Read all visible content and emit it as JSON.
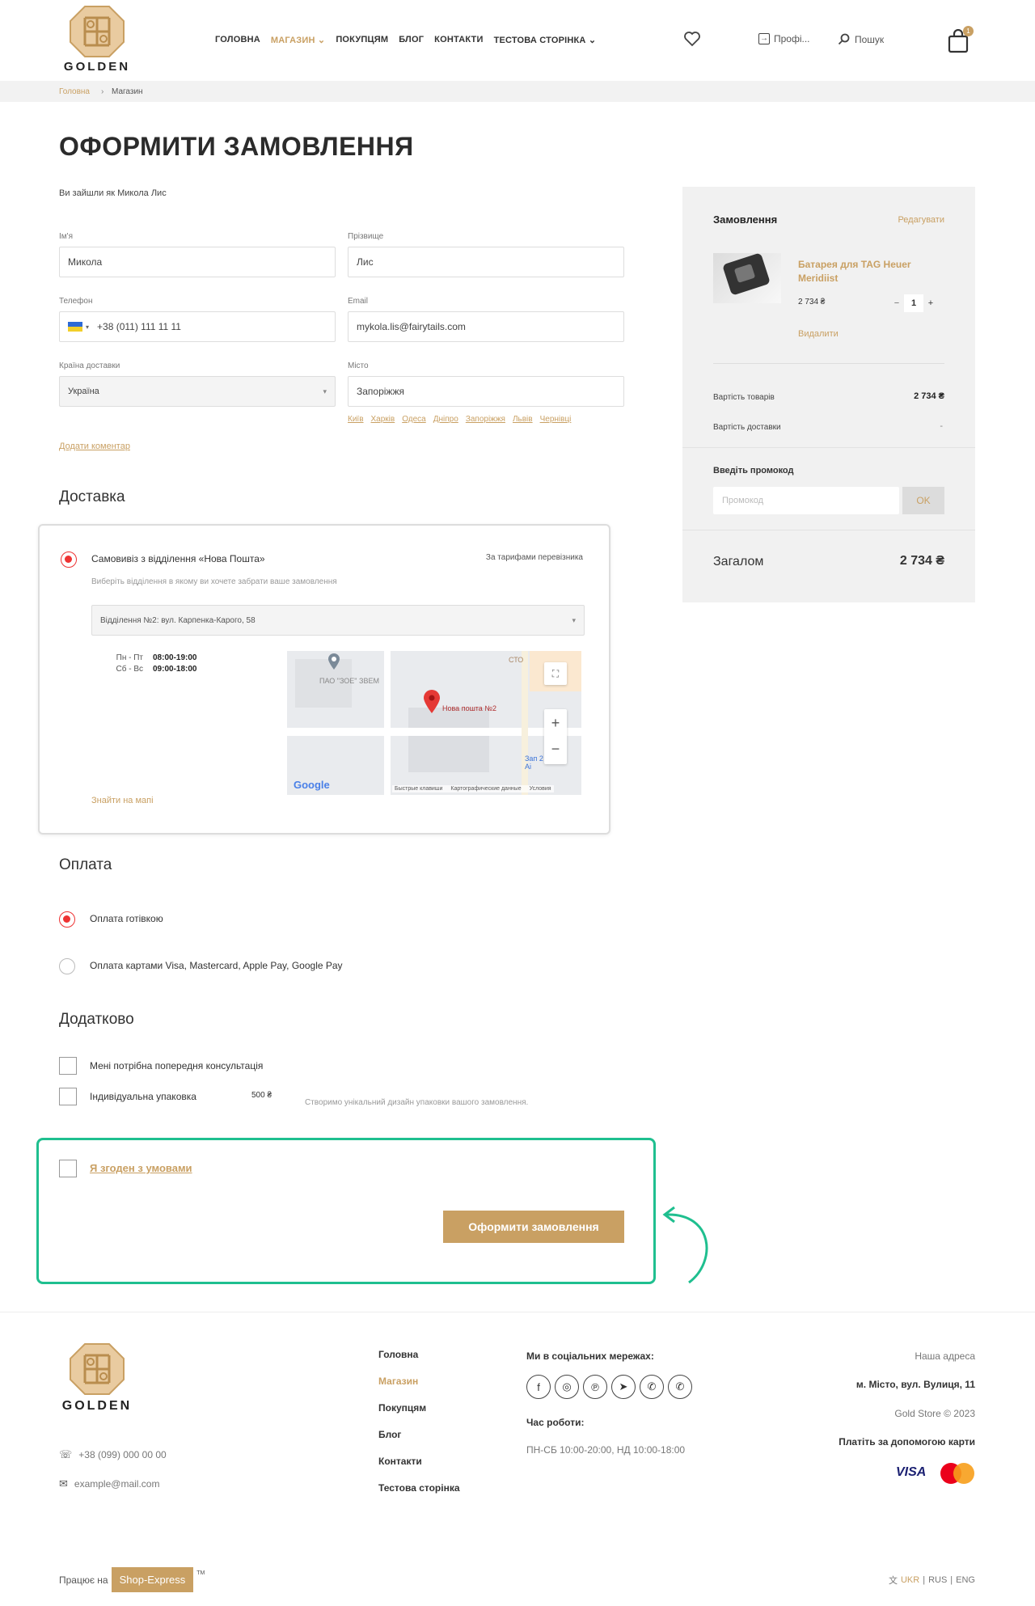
{
  "header": {
    "logo_text": "GOLDEN",
    "nav": [
      {
        "label": "ГОЛОВНА"
      },
      {
        "label": "МАГАЗИН ⌄"
      },
      {
        "label": "ПОКУПЦЯМ"
      },
      {
        "label": "БЛОГ"
      },
      {
        "label": "КОНТАКТИ"
      },
      {
        "label": "ТЕСТОВА СТОРІНКА ⌄"
      }
    ],
    "profile_label": "Профі...",
    "search_label": "Пошук",
    "cart_count": "1",
    "accent_color": "#c9a063"
  },
  "breadcrumb": {
    "home": "Головна",
    "sep": "›",
    "current": "Магазин"
  },
  "page_title": "ОФОРМИТИ ЗАМОВЛЕННЯ",
  "logged_in_text": "Ви зайшли як Микола Лис",
  "form": {
    "first_name_label": "Ім'я",
    "first_name_value": "Микола",
    "last_name_label": "Прізвище",
    "last_name_value": "Лис",
    "phone_label": "Телефон",
    "phone_value": "+38 (011) 111 11 11",
    "email_label": "Email",
    "email_value": "mykola.lis@fairytails.com",
    "country_label": "Країна доставки",
    "country_value": "Україна",
    "city_label": "Місто",
    "city_value": "Запоріжжя",
    "city_suggestions": [
      "Київ",
      "Харків",
      "Одеса",
      "Дніпро",
      "Запоріжжя",
      "Львів",
      "Чернівці"
    ],
    "add_comment": "Додати коментар"
  },
  "delivery": {
    "title": "Доставка",
    "option_label": "Самовивіз з відділення «Нова Пошта»",
    "tariff": "За тарифами перевізника",
    "hint": "Виберіть відділення в якому ви хочете забрати ваше замовлення",
    "branch_value": "Відділення №2: вул. Карпенка-Карого, 58",
    "schedule": [
      {
        "days": "Пн - Пт",
        "hours": "08:00-19:00"
      },
      {
        "days": "Сб - Вс",
        "hours": "09:00-18:00"
      }
    ],
    "find_on_map": "Знайти на мапі",
    "map": {
      "poi_1": "ПАО \"ЗОЕ\" ЗВЕМ",
      "poi_2": "Нова пошта №2",
      "poi_3": "СТО",
      "poi_4": "Зап 2 Аі",
      "brand": "Google",
      "footer_1": "Быстрые клавиши",
      "footer_2": "Картографические данные",
      "footer_3": "Условия"
    }
  },
  "payment": {
    "title": "Оплата",
    "option_cash": "Оплата готівкою",
    "option_card": "Оплата картами Visa, Mastercard, Apple Pay, Google Pay"
  },
  "extra": {
    "title": "Додатково",
    "consult": "Мені потрібна попередня консультація",
    "packaging": "Індивідуальна упаковка",
    "packaging_price": "500 ₴",
    "packaging_hint": "Створимо унікальний дизайн упаковки вашого замовлення."
  },
  "agree": {
    "label": "Я згоден з умовами",
    "submit": "Оформити замовлення",
    "highlight_color": "#1fbf8f"
  },
  "order": {
    "title": "Замовлення",
    "edit": "Редагувати",
    "product_name": "Батарея для TAG Heuer Meridiist",
    "product_price": "2 734 ₴",
    "qty_minus": "−",
    "qty": "1",
    "qty_plus": "+",
    "remove": "Видалити",
    "goods_cost_label": "Вартість товарів",
    "goods_cost_value": "2 734 ₴",
    "delivery_cost_label": "Вартість доставки",
    "delivery_cost_value": "-",
    "promo_label": "Введіть промокод",
    "promo_placeholder": "Промокод",
    "promo_ok": "OK",
    "total_label": "Загалом",
    "total_value": "2 734 ₴"
  },
  "footer": {
    "logo_text": "GOLDEN",
    "phone": "+38 (099) 000 00 00",
    "email": "example@mail.com",
    "nav": [
      "Головна",
      "Магазин",
      "Покупцям",
      "Блог",
      "Контакти",
      "Тестова сторінка"
    ],
    "social_title": "Ми в соціальних мережах:",
    "social_icons": [
      "facebook-icon",
      "instagram-icon",
      "pinterest-icon",
      "telegram-icon",
      "viber-icon",
      "whatsapp-icon"
    ],
    "hours_title": "Час роботи:",
    "hours_value": "ПН-СБ 10:00-20:00, НД 10:00-18:00",
    "address_title": "Наша адреса",
    "address_value": "м. Місто, вул. Вулиця, 11",
    "copyright": "Gold Store © 2023",
    "pay_title": "Платіть за допомогою карти",
    "visa": "VISA",
    "works_on": "Працює на",
    "platform": "Shop-Express",
    "tm": "TM",
    "lang_ukr": "UKR",
    "lang_rus": "RUS",
    "lang_eng": "ENG",
    "lang_sep": "|"
  }
}
